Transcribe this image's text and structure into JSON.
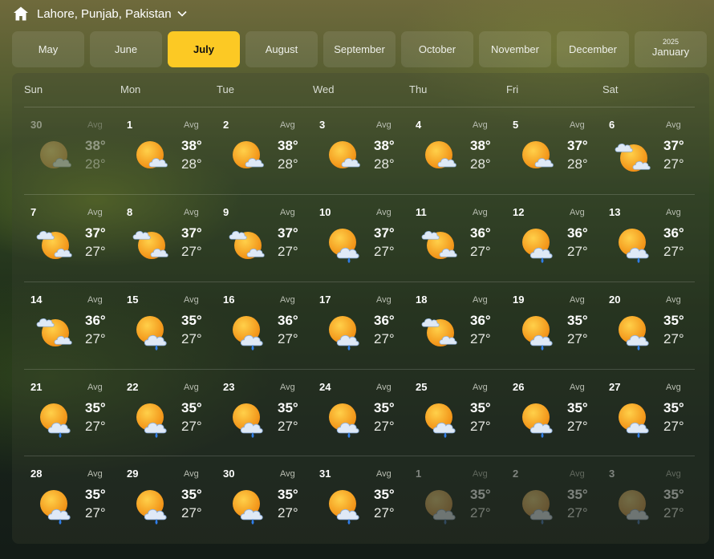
{
  "header": {
    "location": "Lahore, Punjab, Pakistan",
    "home_icon": "home-icon",
    "dropdown_icon": "chevron-down-icon"
  },
  "months": [
    {
      "label": "May",
      "year": "",
      "active": false
    },
    {
      "label": "June",
      "year": "",
      "active": false
    },
    {
      "label": "July",
      "year": "",
      "active": true
    },
    {
      "label": "August",
      "year": "",
      "active": false
    },
    {
      "label": "September",
      "year": "",
      "active": false
    },
    {
      "label": "October",
      "year": "",
      "active": false
    },
    {
      "label": "November",
      "year": "",
      "active": false
    },
    {
      "label": "December",
      "year": "",
      "active": false
    },
    {
      "label": "January",
      "year": "2025",
      "active": false
    }
  ],
  "colors": {
    "accent": "#fcc924"
  },
  "weekdays": [
    "Sun",
    "Mon",
    "Tue",
    "Wed",
    "Thu",
    "Fri",
    "Sat"
  ],
  "avg_label": "Avg",
  "days": [
    {
      "day": "30",
      "hi": "38°",
      "lo": "28°",
      "icon": "sun-cloud",
      "dim": true
    },
    {
      "day": "1",
      "hi": "38°",
      "lo": "28°",
      "icon": "sun-cloud",
      "dim": false
    },
    {
      "day": "2",
      "hi": "38°",
      "lo": "28°",
      "icon": "sun-cloud",
      "dim": false
    },
    {
      "day": "3",
      "hi": "38°",
      "lo": "28°",
      "icon": "sun-cloud",
      "dim": false
    },
    {
      "day": "4",
      "hi": "38°",
      "lo": "28°",
      "icon": "sun-cloud",
      "dim": false
    },
    {
      "day": "5",
      "hi": "37°",
      "lo": "28°",
      "icon": "sun-cloud",
      "dim": false
    },
    {
      "day": "6",
      "hi": "37°",
      "lo": "27°",
      "icon": "sun-two-clouds",
      "dim": false
    },
    {
      "day": "7",
      "hi": "37°",
      "lo": "27°",
      "icon": "sun-two-clouds",
      "dim": false
    },
    {
      "day": "8",
      "hi": "37°",
      "lo": "27°",
      "icon": "sun-two-clouds",
      "dim": false
    },
    {
      "day": "9",
      "hi": "37°",
      "lo": "27°",
      "icon": "sun-two-clouds",
      "dim": false
    },
    {
      "day": "10",
      "hi": "37°",
      "lo": "27°",
      "icon": "sun-cloud-rain",
      "dim": false
    },
    {
      "day": "11",
      "hi": "36°",
      "lo": "27°",
      "icon": "sun-two-clouds",
      "dim": false
    },
    {
      "day": "12",
      "hi": "36°",
      "lo": "27°",
      "icon": "sun-cloud-rain",
      "dim": false
    },
    {
      "day": "13",
      "hi": "36°",
      "lo": "27°",
      "icon": "sun-cloud-rain",
      "dim": false
    },
    {
      "day": "14",
      "hi": "36°",
      "lo": "27°",
      "icon": "sun-two-clouds",
      "dim": false
    },
    {
      "day": "15",
      "hi": "35°",
      "lo": "27°",
      "icon": "sun-cloud-rain",
      "dim": false
    },
    {
      "day": "16",
      "hi": "36°",
      "lo": "27°",
      "icon": "sun-cloud-rain",
      "dim": false
    },
    {
      "day": "17",
      "hi": "36°",
      "lo": "27°",
      "icon": "sun-cloud-rain",
      "dim": false
    },
    {
      "day": "18",
      "hi": "36°",
      "lo": "27°",
      "icon": "sun-two-clouds",
      "dim": false
    },
    {
      "day": "19",
      "hi": "35°",
      "lo": "27°",
      "icon": "sun-cloud-rain",
      "dim": false
    },
    {
      "day": "20",
      "hi": "35°",
      "lo": "27°",
      "icon": "sun-cloud-rain",
      "dim": false
    },
    {
      "day": "21",
      "hi": "35°",
      "lo": "27°",
      "icon": "sun-cloud-rain",
      "dim": false
    },
    {
      "day": "22",
      "hi": "35°",
      "lo": "27°",
      "icon": "sun-cloud-rain",
      "dim": false
    },
    {
      "day": "23",
      "hi": "35°",
      "lo": "27°",
      "icon": "sun-cloud-rain",
      "dim": false
    },
    {
      "day": "24",
      "hi": "35°",
      "lo": "27°",
      "icon": "sun-cloud-rain",
      "dim": false
    },
    {
      "day": "25",
      "hi": "35°",
      "lo": "27°",
      "icon": "sun-cloud-rain",
      "dim": false
    },
    {
      "day": "26",
      "hi": "35°",
      "lo": "27°",
      "icon": "sun-cloud-rain",
      "dim": false
    },
    {
      "day": "27",
      "hi": "35°",
      "lo": "27°",
      "icon": "sun-cloud-rain",
      "dim": false
    },
    {
      "day": "28",
      "hi": "35°",
      "lo": "27°",
      "icon": "sun-cloud-rain",
      "dim": false
    },
    {
      "day": "29",
      "hi": "35°",
      "lo": "27°",
      "icon": "sun-cloud-rain",
      "dim": false
    },
    {
      "day": "30",
      "hi": "35°",
      "lo": "27°",
      "icon": "sun-cloud-rain",
      "dim": false
    },
    {
      "day": "31",
      "hi": "35°",
      "lo": "27°",
      "icon": "sun-cloud-rain",
      "dim": false
    },
    {
      "day": "1",
      "hi": "35°",
      "lo": "27°",
      "icon": "sun-cloud-rain",
      "dim": true
    },
    {
      "day": "2",
      "hi": "35°",
      "lo": "27°",
      "icon": "sun-cloud-rain",
      "dim": true
    },
    {
      "day": "3",
      "hi": "35°",
      "lo": "27°",
      "icon": "sun-cloud-rain",
      "dim": true
    }
  ]
}
